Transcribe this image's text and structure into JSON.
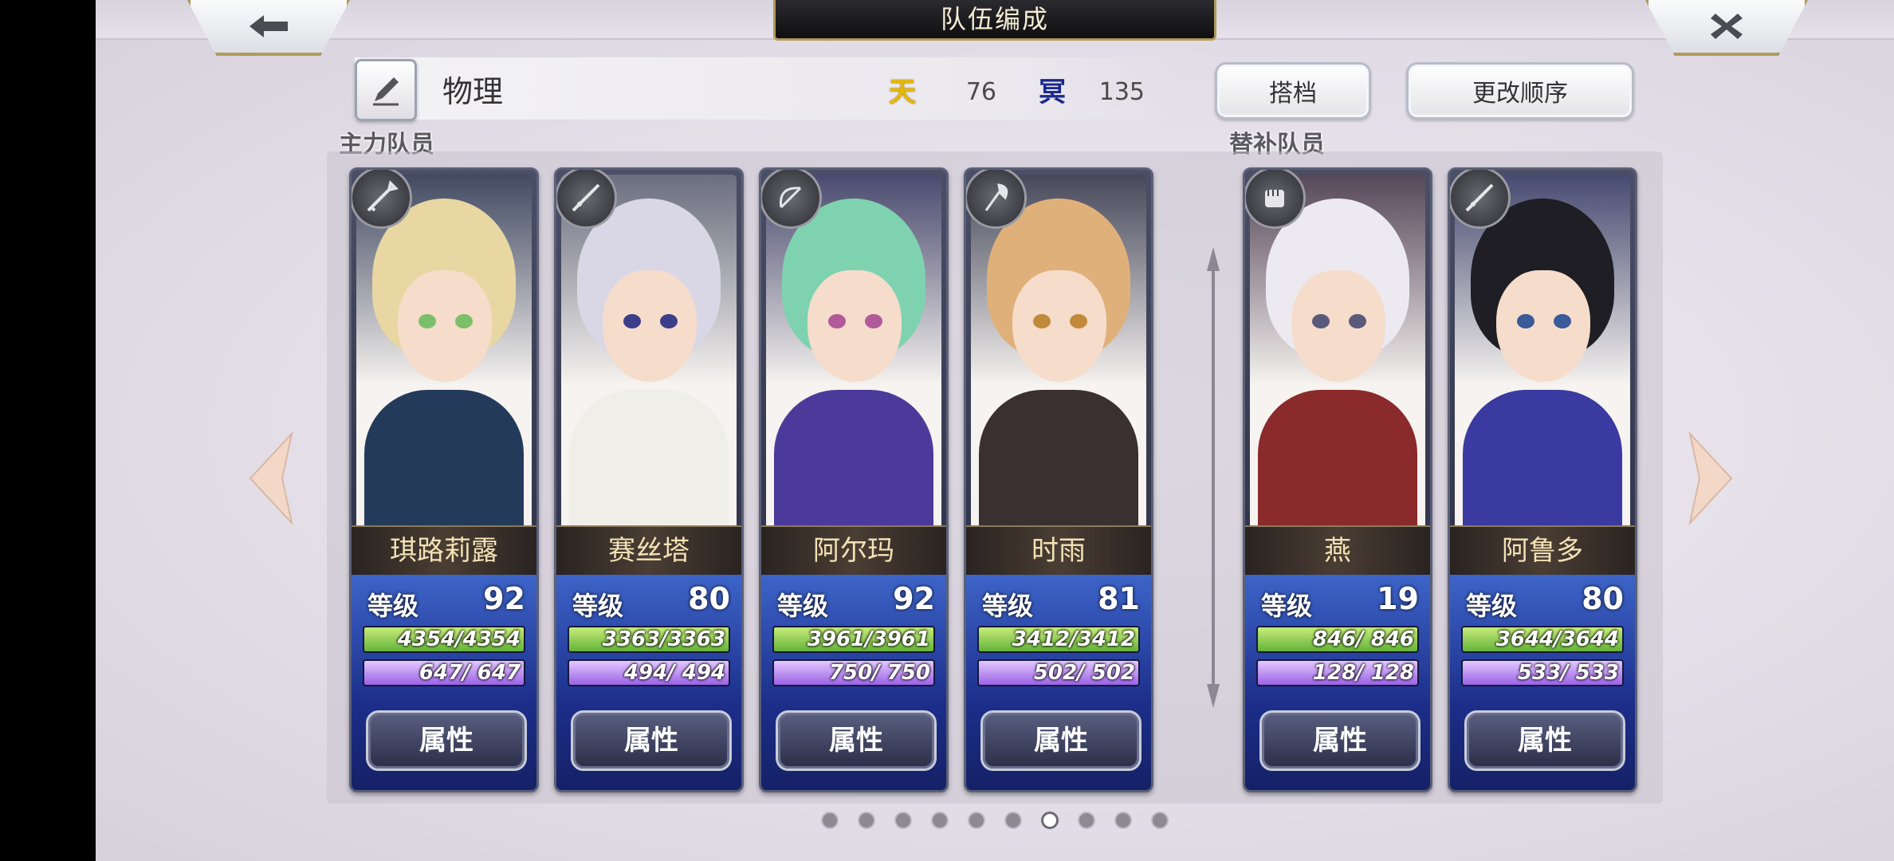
{
  "header": {
    "title": "队伍编成",
    "back_icon": "arrow-left-icon",
    "close_icon": "close-icon"
  },
  "team": {
    "name": "物理",
    "resource_1": {
      "icon_text": "天",
      "value": "76",
      "color": "#e6b800"
    },
    "resource_2": {
      "icon_text": "冥",
      "value": "135",
      "color": "#1b2a8a"
    },
    "partner_label": "搭档",
    "reorder_label": "更改顺序"
  },
  "sections": {
    "main": "主力队员",
    "reserve": "替补队员"
  },
  "labels": {
    "level": "等级",
    "attribute": "属性"
  },
  "members": [
    {
      "name": "琪路莉露",
      "level": "92",
      "hp": "4354/4354",
      "mp": "647/ 647",
      "weapon": "spear-icon",
      "palette": {
        "hair": "#e8d7a2",
        "eye": "#7bbf6a",
        "body": "#243a5a"
      }
    },
    {
      "name": "赛丝塔",
      "level": "80",
      "hp": "3363/3363",
      "mp": "494/ 494",
      "weapon": "sword-icon",
      "palette": {
        "hair": "#d9d6e6",
        "eye": "#3b3f8a",
        "body": "#f0eee8"
      }
    },
    {
      "name": "阿尔玛",
      "level": "92",
      "hp": "3961/3961",
      "mp": "750/ 750",
      "weapon": "bow-icon",
      "palette": {
        "hair": "#7fd2b0",
        "eye": "#b05a9a",
        "body": "#4b3a9a"
      }
    },
    {
      "name": "时雨",
      "level": "81",
      "hp": "3412/3412",
      "mp": "502/ 502",
      "weapon": "axe-icon",
      "palette": {
        "hair": "#e0b07a",
        "eye": "#c08a3a",
        "body": "#3a3030"
      }
    },
    {
      "name": "燕",
      "level": "19",
      "hp": "846/ 846",
      "mp": "128/ 128",
      "weapon": "fist-icon",
      "palette": {
        "hair": "#eceaf0",
        "eye": "#5a5a7a",
        "body": "#8a2a2a"
      }
    },
    {
      "name": "阿鲁多",
      "level": "80",
      "hp": "3644/3644",
      "mp": "533/ 533",
      "weapon": "sword-icon",
      "palette": {
        "hair": "#1e1e24",
        "eye": "#3a5a9a",
        "body": "#3a3aa0"
      }
    }
  ],
  "pagination": {
    "pages": 10,
    "current": 7
  }
}
